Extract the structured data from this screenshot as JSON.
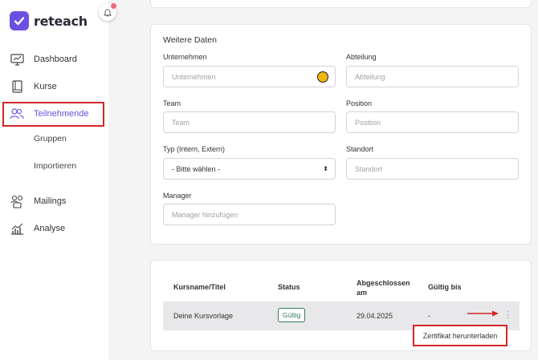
{
  "brand": {
    "name": "reteach",
    "color": "#6b4fe0"
  },
  "sidebar": {
    "items": [
      {
        "label": "Dashboard",
        "icon": "dashboard-icon"
      },
      {
        "label": "Kurse",
        "icon": "book-icon"
      },
      {
        "label": "Teilnehmende",
        "icon": "users-icon",
        "active": true
      },
      {
        "label": "Gruppen"
      },
      {
        "label": "Importieren"
      },
      {
        "label": "Mailings",
        "icon": "mailing-icon"
      },
      {
        "label": "Analyse",
        "icon": "analytics-icon"
      }
    ]
  },
  "form": {
    "title": "Weitere Daten",
    "company": {
      "label": "Unternehmen",
      "placeholder": "Unternehmen"
    },
    "department": {
      "label": "Abteilung",
      "placeholder": "Abteilung"
    },
    "team": {
      "label": "Team",
      "placeholder": "Team"
    },
    "position": {
      "label": "Position",
      "placeholder": "Position"
    },
    "type": {
      "label": "Typ (Intern, Extern)",
      "value": "- Bitte wählen -"
    },
    "location": {
      "label": "Standort",
      "placeholder": "Standort"
    },
    "manager": {
      "label": "Manager",
      "placeholder": "Manager hinzufügen"
    }
  },
  "table": {
    "headers": [
      "Kursname/Titel",
      "Status",
      "Abgeschlossen am",
      "Gültig bis"
    ],
    "header_abgeschlossen_line1": "Abgeschlossen",
    "header_abgeschlossen_line2": "am",
    "rows": [
      {
        "title": "Deine Kursvorlage",
        "status": "Gültig",
        "completed": "29.04.2025",
        "valid_until": "-"
      }
    ],
    "menu_item": "Zertifikat herunterladen"
  },
  "colors": {
    "highlight": "#d32626",
    "status_green": "#2f7d5b"
  }
}
